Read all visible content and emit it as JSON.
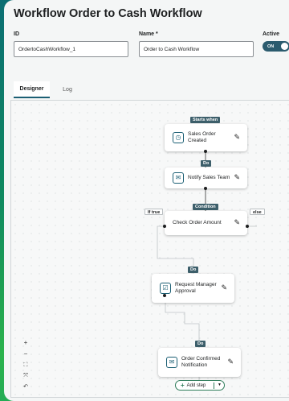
{
  "header": {
    "title": "Workflow Order to Cash Workflow"
  },
  "form": {
    "id_label": "ID",
    "id_value": "OrdertoCashWorkflow_1",
    "name_label": "Name *",
    "name_value": "Order to Cash Workflow",
    "active_label": "Active",
    "active_toggle": "ON"
  },
  "tabs": [
    {
      "label": "Designer"
    },
    {
      "label": "Log"
    }
  ],
  "badges": {
    "starts_when": "Starts when",
    "do1": "Do",
    "condition": "Condition",
    "if_true": "If true",
    "else": "else",
    "do2": "Do",
    "do3": "Do"
  },
  "nodes": [
    {
      "line1": "Sales Order",
      "line2": "Created",
      "icon": "trigger-icon"
    },
    {
      "line1": "Notify Sales Team",
      "line2": "",
      "icon": "notify-icon"
    },
    {
      "line1": "Check Order Amount",
      "line2": "",
      "icon": "none"
    },
    {
      "line1": "Request Manager",
      "line2": "Approval",
      "icon": "approval-icon"
    },
    {
      "line1": "Order Confirmed",
      "line2": "Notification",
      "icon": "notify-icon"
    }
  ],
  "zoom_controls": {
    "zoom_in": "+",
    "zoom_out": "−",
    "fit": "⛶",
    "collapse": "⤧",
    "undo": "↶"
  },
  "add_step": {
    "label": "Add step"
  }
}
